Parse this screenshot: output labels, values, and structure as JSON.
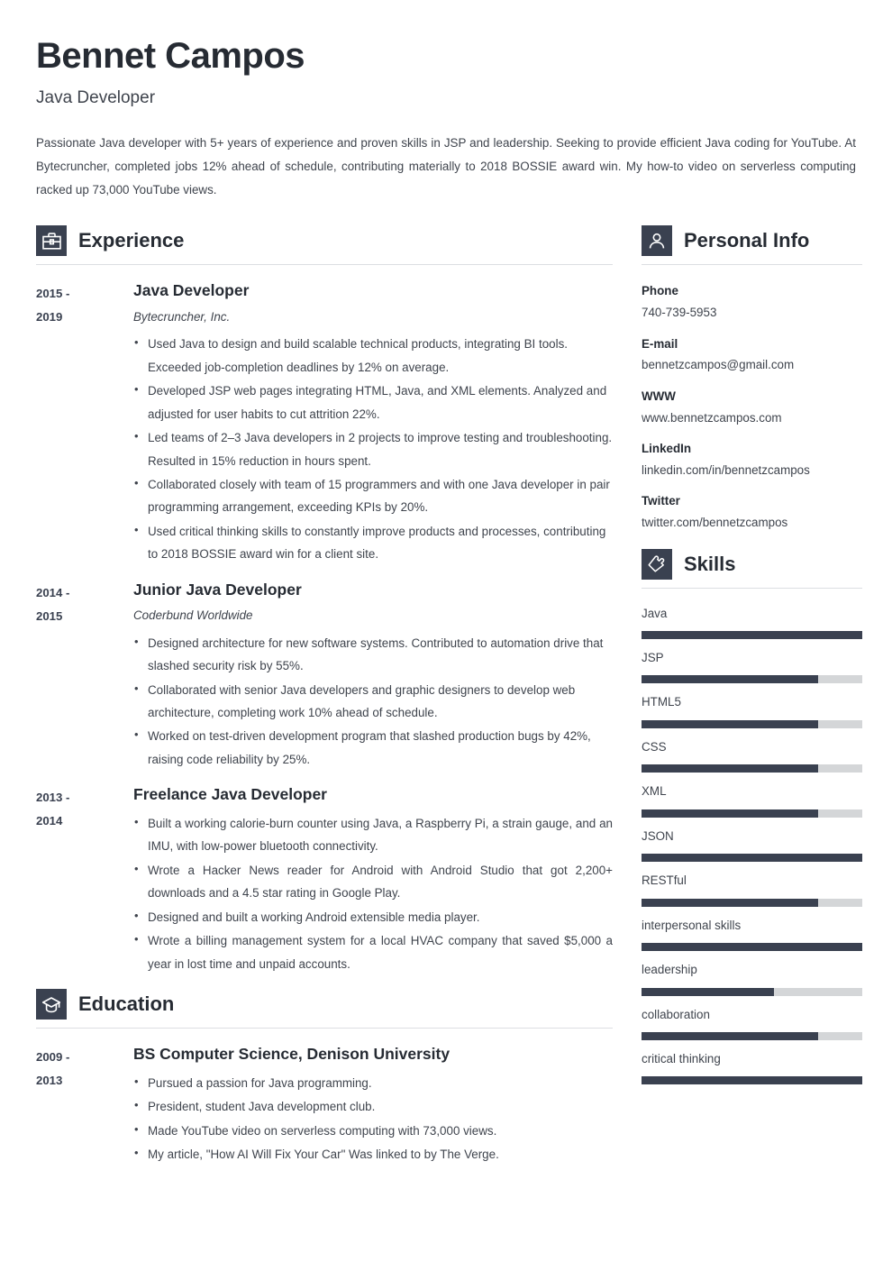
{
  "header": {
    "name": "Bennet Campos",
    "job_title": "Java Developer",
    "summary": "Passionate Java developer with 5+ years of experience and proven skills in JSP and leadership. Seeking to provide efficient Java coding for YouTube. At Bytecruncher, completed jobs 12% ahead of schedule, contributing materially to 2018 BOSSIE award win. My how-to video on serverless computing racked up 73,000 YouTube views."
  },
  "theme": {
    "accent": "#3a4150",
    "text": "#3f444d",
    "heading": "#262b33",
    "rule": "#dcdee2",
    "track": "#d4d6d8"
  },
  "experience": {
    "title": "Experience",
    "icon": "briefcase-icon",
    "entries": [
      {
        "date_start": "2015 -",
        "date_end": "2019",
        "role": "Java Developer",
        "company": "Bytecruncher, Inc.",
        "justify": false,
        "bullets": [
          "Used Java to design and build scalable technical products, integrating BI tools. Exceeded job-completion deadlines by 12% on average.",
          "Developed JSP web pages integrating HTML, Java, and XML elements. Analyzed and adjusted for user habits to cut attrition 22%.",
          "Led teams of 2–3 Java developers in 2 projects to improve testing and troubleshooting. Resulted in 15% reduction in hours spent.",
          "Collaborated closely with team of 15 programmers and with one Java developer in pair programming arrangement, exceeding KPIs by 20%.",
          "Used critical thinking skills to constantly improve products and processes, contributing to 2018 BOSSIE award win for a client site."
        ]
      },
      {
        "date_start": "2014 -",
        "date_end": "2015",
        "role": "Junior Java Developer",
        "company": "Coderbund Worldwide",
        "justify": false,
        "bullets": [
          "Designed architecture for new software systems. Contributed to automation drive that slashed security risk by 55%.",
          "Collaborated with senior Java developers and graphic designers to develop web architecture, completing work 10% ahead of schedule.",
          "Worked on test-driven development program that slashed production bugs by 42%, raising code reliability by 25%."
        ]
      },
      {
        "date_start": "2013 -",
        "date_end": "2014",
        "role": "Freelance Java Developer",
        "company": "",
        "justify": true,
        "bullets": [
          "Built a working calorie-burn counter using Java, a Raspberry Pi, a strain gauge, and an IMU, with low-power bluetooth connectivity.",
          "Wrote a Hacker News reader for Android with Android Studio that got 2,200+ downloads and a 4.5 star rating in Google Play.",
          "Designed and built a working Android extensible media player.",
          "Wrote a billing management system for a local HVAC company that saved $5,000 a year in lost time and unpaid accounts."
        ]
      }
    ]
  },
  "education": {
    "title": "Education",
    "icon": "graduation-cap-icon",
    "entries": [
      {
        "date_start": "2009 -",
        "date_end": "2013",
        "role": "BS Computer Science, Denison University",
        "company": "",
        "justify": false,
        "bullets": [
          "Pursued a passion for Java programming.",
          "President, student Java development club.",
          "Made YouTube video on serverless computing with 73,000 views.",
          "My article, \"How AI Will Fix Your Car\" Was linked to by The Verge."
        ]
      }
    ]
  },
  "personal_info": {
    "title": "Personal Info",
    "icon": "person-icon",
    "items": [
      {
        "label": "Phone",
        "value": "740-739-5953"
      },
      {
        "label": "E-mail",
        "value": "bennetzcampos@gmail.com"
      },
      {
        "label": "WWW",
        "value": "www.bennetzcampos.com"
      },
      {
        "label": "LinkedIn",
        "value": "linkedin.com/in/bennetzcampos"
      },
      {
        "label": "Twitter",
        "value": "twitter.com/bennetzcampos"
      }
    ]
  },
  "skills": {
    "title": "Skills",
    "icon": "puzzle-piece-icon",
    "items": [
      {
        "name": "Java",
        "level": 100
      },
      {
        "name": "JSP",
        "level": 80
      },
      {
        "name": "HTML5",
        "level": 80
      },
      {
        "name": "CSS",
        "level": 80
      },
      {
        "name": "XML",
        "level": 80
      },
      {
        "name": "JSON",
        "level": 100
      },
      {
        "name": "RESTful",
        "level": 80
      },
      {
        "name": "interpersonal skills",
        "level": 100
      },
      {
        "name": "leadership",
        "level": 60
      },
      {
        "name": "collaboration",
        "level": 80
      },
      {
        "name": "critical thinking",
        "level": 100
      }
    ]
  }
}
